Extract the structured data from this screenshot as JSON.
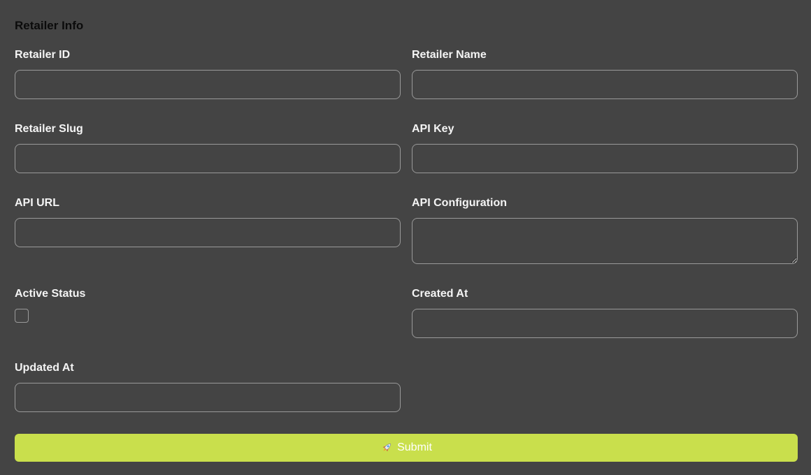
{
  "form": {
    "title": "Retailer Info",
    "fields": {
      "retailer_id": {
        "label": "Retailer ID",
        "value": ""
      },
      "retailer_name": {
        "label": "Retailer Name",
        "value": ""
      },
      "retailer_slug": {
        "label": "Retailer Slug",
        "value": ""
      },
      "api_key": {
        "label": "API Key",
        "value": ""
      },
      "api_url": {
        "label": "API URL",
        "value": ""
      },
      "api_configuration": {
        "label": "API Configuration",
        "value": ""
      },
      "active_status": {
        "label": "Active Status",
        "checked": false
      },
      "created_at": {
        "label": "Created At",
        "value": ""
      },
      "updated_at": {
        "label": "Updated At",
        "value": ""
      }
    },
    "submit": {
      "label": "Submit",
      "icon": "rocket-icon",
      "color": "#c9df4c"
    }
  },
  "colors": {
    "background": "#444444",
    "border": "#9a9a9a",
    "title": "#0b0b0b",
    "label": "#f4f4f4"
  }
}
